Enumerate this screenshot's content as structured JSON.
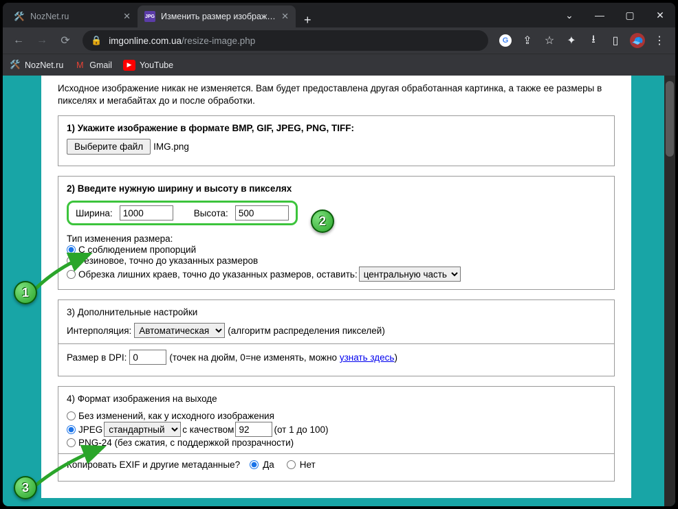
{
  "browser": {
    "tabs": [
      {
        "title": "NozNet.ru"
      },
      {
        "title": "Изменить размер изображения"
      }
    ],
    "url_domain": "imgonline.com.ua",
    "url_path": "/resize-image.php",
    "bookmarks": [
      {
        "label": "NozNet.ru"
      },
      {
        "label": "Gmail"
      },
      {
        "label": "YouTube"
      }
    ]
  },
  "intro": "Исходное изображение никак не изменяется. Вам будет предоставлена другая обработанная картинка, а также ее размеры в пикселях и мегабайтах до и после обработки.",
  "section1": {
    "title": "1) Укажите изображение в формате BMP, GIF, JPEG, PNG, TIFF:",
    "button": "Выберите файл",
    "filename": "IMG.png"
  },
  "section2": {
    "title": "2) Введите нужную ширину и высоту в пикселях",
    "width_label": "Ширина:",
    "width_value": "1000",
    "height_label": "Высота:",
    "height_value": "500",
    "resize_label": "Тип изменения размера:",
    "opt_prop": "С соблюдением пропорций",
    "opt_stretch": "Резиновое, точно до указанных размеров",
    "opt_crop": "Обрезка лишних краев, точно до указанных размеров, оставить:",
    "crop_select": "центральную часть"
  },
  "section3": {
    "title": "3) Дополнительные настройки",
    "interp_label": "Интерполяция:",
    "interp_value": "Автоматическая",
    "interp_hint": "(алгоритм распределения пикселей)",
    "dpi_label": "Размер в DPI:",
    "dpi_value": "0",
    "dpi_hint_a": "(точек на дюйм, 0=не изменять, можно ",
    "dpi_link": "узнать здесь",
    "dpi_hint_b": ")"
  },
  "section4": {
    "title": "4) Формат изображения на выходе",
    "opt_same": "Без изменений, как у исходного изображения",
    "opt_jpeg": "JPEG",
    "jpeg_quality_select": "стандартный",
    "jpeg_q_label": "с качеством",
    "jpeg_q_value": "92",
    "jpeg_q_hint": "(от 1 до 100)",
    "opt_png": "PNG-24 (без сжатия, с поддержкой прозрачности)",
    "exif_label": "Копировать EXIF и другие метаданные?",
    "exif_yes": "Да",
    "exif_no": "Нет"
  },
  "badges": {
    "b1": "1",
    "b2": "2",
    "b3": "3"
  }
}
